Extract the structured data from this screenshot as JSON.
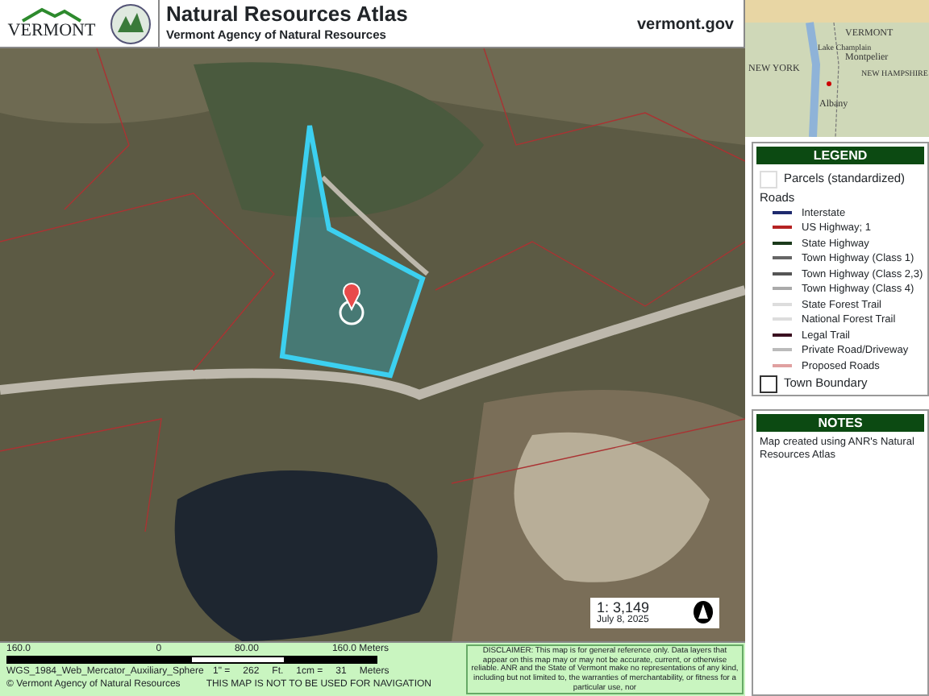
{
  "header": {
    "title": "Natural Resources Atlas",
    "subtitle": "Vermont Agency of Natural Resources",
    "logo_text": "VERMONT",
    "site": "vermont.gov"
  },
  "inset_map": {
    "labels": [
      "VERMONT",
      "Lake Champlain",
      "Montpelier",
      "NEW YORK",
      "NEW HAMPSHIRE",
      "Albany"
    ]
  },
  "map": {
    "scale_text": "1: 3,149",
    "date": "July 8, 2025"
  },
  "legend": {
    "title": "LEGEND",
    "items": [
      {
        "kind": "box",
        "label": "Parcels (standardized)"
      },
      {
        "kind": "heading",
        "label": "Roads"
      },
      {
        "kind": "line",
        "label": "Interstate",
        "color": "#1f2a6e"
      },
      {
        "kind": "line",
        "label": "US Highway; 1",
        "color": "#b52222"
      },
      {
        "kind": "line",
        "label": "State Highway",
        "color": "#1b3a1b"
      },
      {
        "kind": "line",
        "label": "Town Highway (Class 1)",
        "color": "#666666"
      },
      {
        "kind": "line",
        "label": "Town Highway (Class 2,3)",
        "color": "#555555"
      },
      {
        "kind": "line",
        "label": "Town Highway (Class 4)",
        "color": "#aaaaaa"
      },
      {
        "kind": "line",
        "label": "State Forest Trail",
        "color": "#dddddd"
      },
      {
        "kind": "line",
        "label": "National Forest Trail",
        "color": "#dddddd"
      },
      {
        "kind": "line",
        "label": "Legal Trail",
        "color": "#3a1020"
      },
      {
        "kind": "line",
        "label": "Private Road/Driveway",
        "color": "#bbbbbb"
      },
      {
        "kind": "line",
        "label": "Proposed Roads",
        "color": "#e0a0a0"
      },
      {
        "kind": "box",
        "label": "Town Boundary"
      }
    ]
  },
  "scale_bar": {
    "ticks": [
      "160.0",
      "0",
      "80.00",
      "160.0 Meters"
    ],
    "projection": "WGS_1984_Web_Mercator_Auxiliary_Sphere",
    "inch_label": "1\" =",
    "inch_value": "262",
    "inch_unit": "Ft.",
    "cm_label": "1cm =",
    "cm_value": "31",
    "cm_unit": "Meters",
    "copyright": "© Vermont Agency of Natural Resources",
    "navigation_note": "THIS MAP IS NOT TO BE USED FOR NAVIGATION"
  },
  "disclaimer": "DISCLAIMER: This map is for general reference only. Data layers that appear on this map may or may not be accurate, current, or otherwise reliable. ANR and the State of Vermont make no representations of any kind, including but not limited to, the warranties of merchantability, or fitness for a particular use, nor",
  "notes": {
    "title": "NOTES",
    "text": "Map created using ANR's Natural Resources Atlas"
  }
}
